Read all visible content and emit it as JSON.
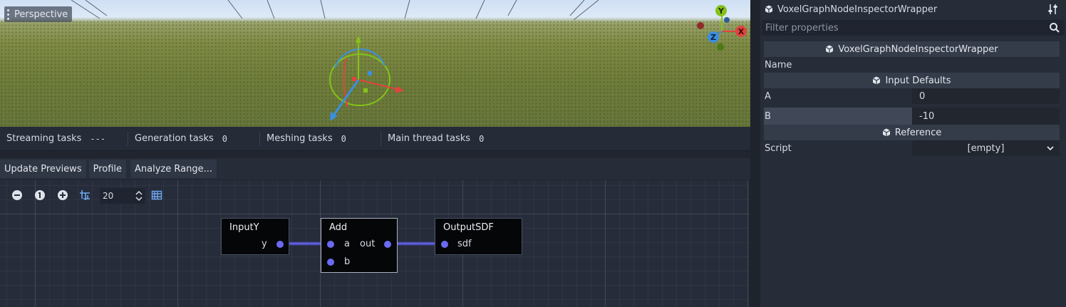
{
  "viewport": {
    "perspective_label": "Perspective"
  },
  "stats": [
    {
      "label": "Streaming tasks",
      "value": "---"
    },
    {
      "label": "Generation tasks",
      "value": "0"
    },
    {
      "label": "Meshing tasks",
      "value": "0"
    },
    {
      "label": "Main thread tasks",
      "value": "0"
    }
  ],
  "toolbar": {
    "update_previews": "Update Previews",
    "profile": "Profile",
    "analyze_range": "Analyze Range..."
  },
  "graph": {
    "zoom_value": "20",
    "nodes": {
      "input_y": {
        "title": "InputY",
        "out_port": "y"
      },
      "add": {
        "title": "Add",
        "in_a": "a",
        "in_b": "b",
        "out_port": "out"
      },
      "output_sdf": {
        "title": "OutputSDF",
        "in_port": "sdf"
      }
    }
  },
  "inspector": {
    "title": "VoxelGraphNodeInspectorWrapper",
    "filter_placeholder": "Filter properties",
    "class_section": "VoxelGraphNodeInspectorWrapper",
    "name_label": "Name",
    "input_defaults_section": "Input Defaults",
    "a_label": "A",
    "a_value": "0",
    "b_label": "B",
    "b_value": "-10",
    "reference_section": "Reference",
    "script_label": "Script",
    "script_value": "[empty]"
  },
  "colors": {
    "port": "#6a6af2",
    "x_axis": "#e0443e",
    "y_axis": "#84c21a",
    "z_axis": "#3b8fe0"
  }
}
